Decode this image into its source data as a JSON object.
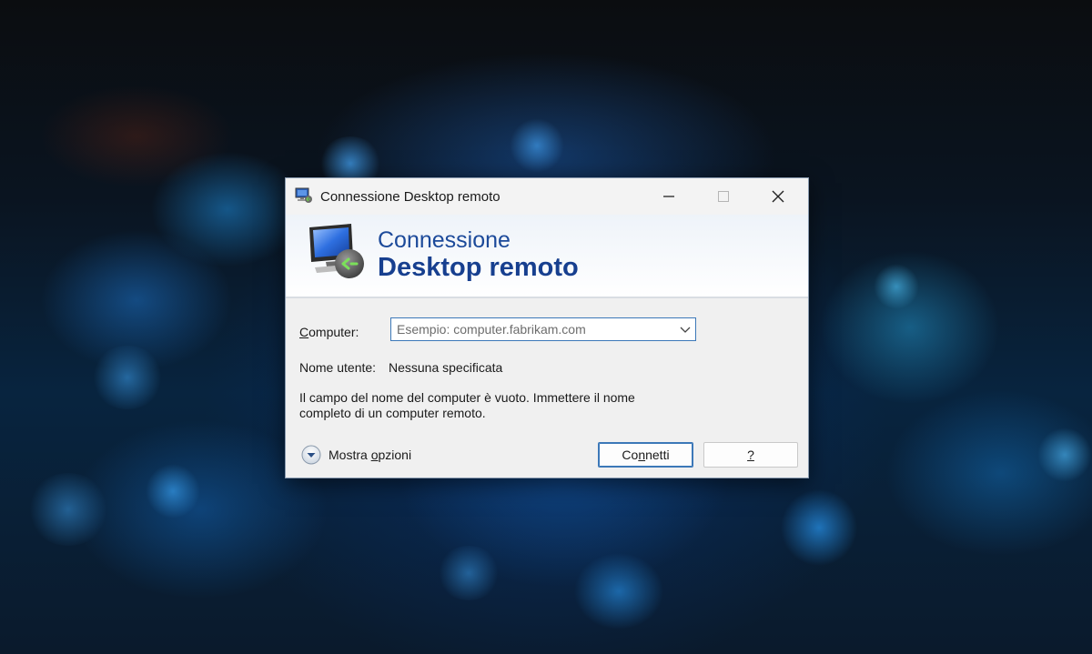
{
  "window": {
    "title": "Connessione Desktop remoto"
  },
  "banner": {
    "line1": "Connessione",
    "line2": "Desktop remoto"
  },
  "form": {
    "computer_label_first": "C",
    "computer_label_rest": "omputer:",
    "computer_placeholder": "Esempio: computer.fabrikam.com",
    "username_label": "Nome utente:",
    "username_value": "Nessuna specificata",
    "message_line1": "Il campo del nome del computer è vuoto. Immettere il nome",
    "message_line2": "completo di un computer remoto."
  },
  "options": {
    "label_before": "Mostra ",
    "label_accel": "o",
    "label_after": "pzioni"
  },
  "buttons": {
    "connect_before": "Co",
    "connect_accel": "n",
    "connect_after": "netti",
    "help_label": "?"
  },
  "icons": {
    "title": "remote-desktop-icon",
    "banner": "remote-desktop-monitor-icon",
    "minimize": "minimize-icon",
    "maximize": "maximize-icon",
    "close": "close-icon",
    "dropdown": "chevron-down-icon",
    "expand": "expand-options-icon"
  },
  "colors": {
    "accent": "#3c78b8",
    "banner_text": "#173f8f"
  }
}
